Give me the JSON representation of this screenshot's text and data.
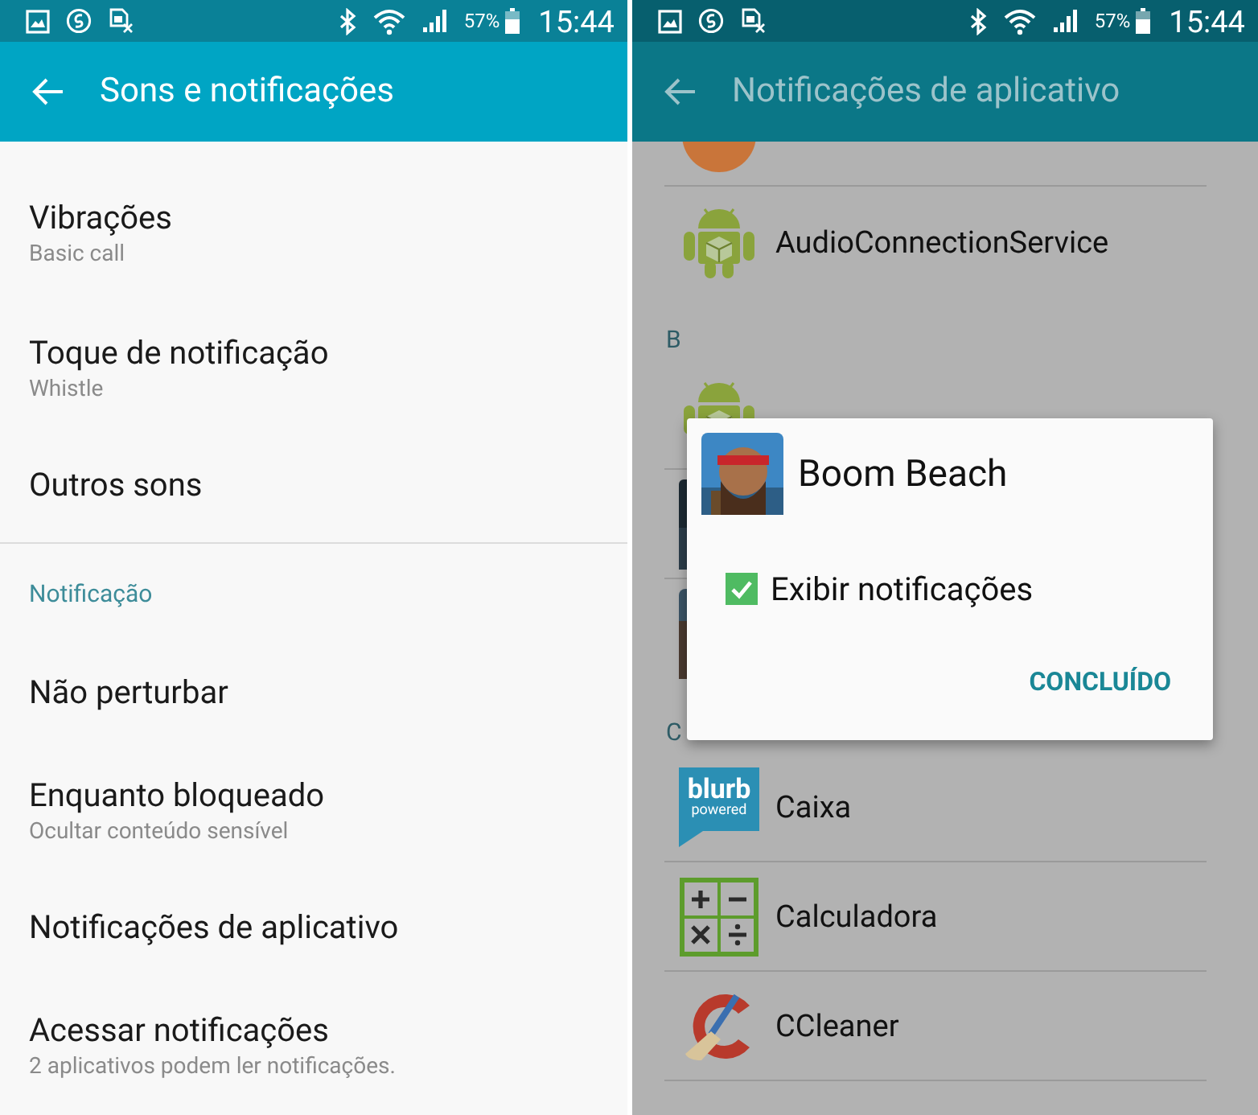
{
  "settings_screen": {
    "dimmed": false,
    "status_bar": {
      "battery": "57%",
      "time": "15:44"
    },
    "app_bar": {
      "title": "Sons e notificações"
    },
    "items": [
      {
        "kind": "setting",
        "title": "Vibrações",
        "subtitle": "Basic call"
      },
      {
        "kind": "setting",
        "title": "Toque de notificação",
        "subtitle": "Whistle"
      },
      {
        "kind": "setting",
        "title": "Outros sons"
      },
      {
        "kind": "header",
        "title": "Notificação"
      },
      {
        "kind": "setting",
        "title": "Não perturbar"
      },
      {
        "kind": "setting",
        "title": "Enquanto bloqueado",
        "subtitle": "Ocultar conteúdo sensível"
      },
      {
        "kind": "setting",
        "title": "Notificações de aplicativo"
      },
      {
        "kind": "setting",
        "title": "Acessar notificações",
        "subtitle": "2 aplicativos podem ler notificações."
      }
    ]
  },
  "app_notifications_screen": {
    "dimmed": true,
    "status_bar": {
      "battery": "57%",
      "time": "15:44"
    },
    "app_bar": {
      "title": "Notificações de aplicativo"
    },
    "items": [
      {
        "kind": "cut_app"
      },
      {
        "kind": "app",
        "name": "AudioConnectionService"
      },
      {
        "kind": "header",
        "title": "B"
      },
      {
        "kind": "covered_app"
      },
      {
        "kind": "covered_app"
      },
      {
        "kind": "covered_app"
      },
      {
        "kind": "header",
        "title": "C"
      },
      {
        "kind": "app",
        "name": "Caixa",
        "icon_text": [
          "blurb",
          "powered"
        ]
      },
      {
        "kind": "app",
        "name": "Calculadora"
      },
      {
        "kind": "app",
        "name": "CCleaner"
      }
    ],
    "dialog": {
      "title": "Boom Beach",
      "checkbox": {
        "label": "Exibir notificações",
        "checked": true
      },
      "button": "CONCLUÍDO"
    }
  }
}
